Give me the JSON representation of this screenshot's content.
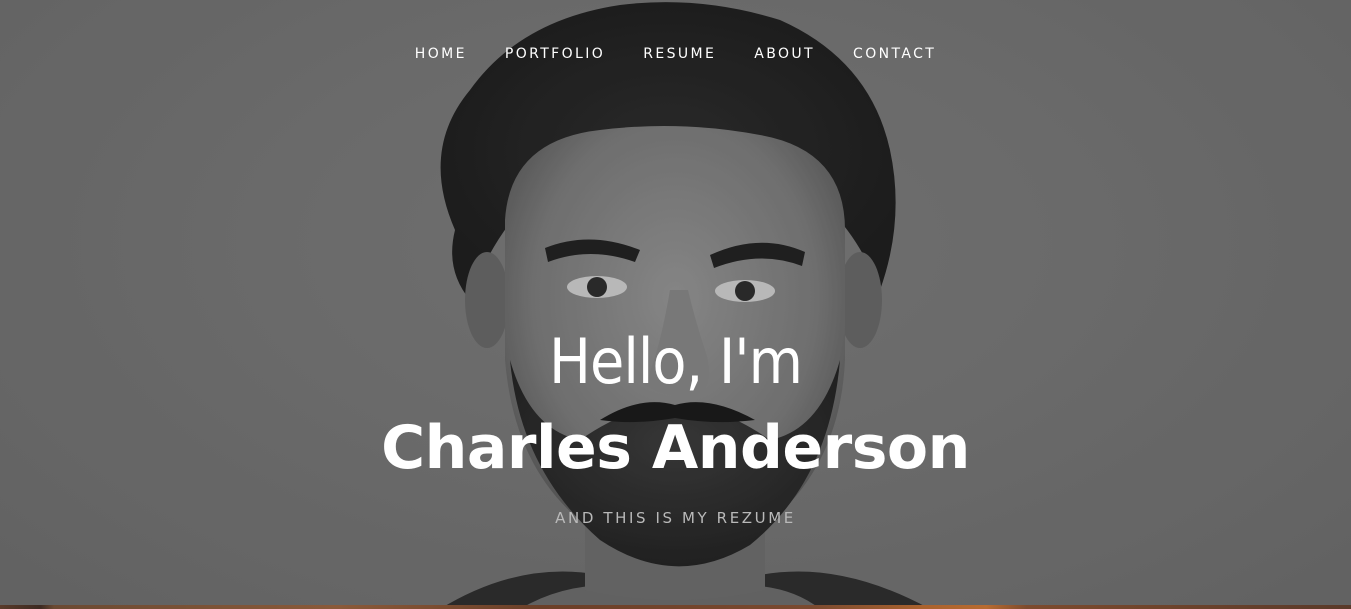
{
  "nav": {
    "items": [
      {
        "label": "HOME"
      },
      {
        "label": "PORTFOLIO"
      },
      {
        "label": "RESUME"
      },
      {
        "label": "ABOUT"
      },
      {
        "label": "CONTACT"
      }
    ]
  },
  "hero": {
    "greeting": "Hello, I'm",
    "name": "Charles Anderson",
    "tagline": "AND THIS IS MY REZUME",
    "background_color": "#757575"
  }
}
